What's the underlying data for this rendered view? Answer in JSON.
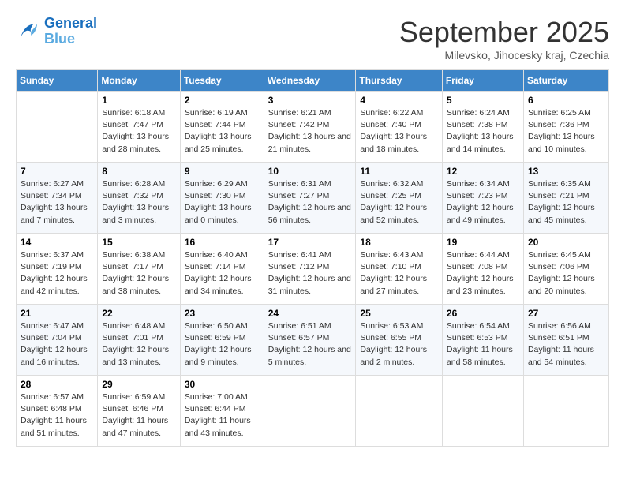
{
  "logo": {
    "line1": "General",
    "line2": "Blue"
  },
  "title": "September 2025",
  "subtitle": "Milevsko, Jihocesky kraj, Czechia",
  "days_header": [
    "Sunday",
    "Monday",
    "Tuesday",
    "Wednesday",
    "Thursday",
    "Friday",
    "Saturday"
  ],
  "weeks": [
    [
      {
        "day": "",
        "info": ""
      },
      {
        "day": "1",
        "info": "Sunrise: 6:18 AM\nSunset: 7:47 PM\nDaylight: 13 hours and 28 minutes."
      },
      {
        "day": "2",
        "info": "Sunrise: 6:19 AM\nSunset: 7:44 PM\nDaylight: 13 hours and 25 minutes."
      },
      {
        "day": "3",
        "info": "Sunrise: 6:21 AM\nSunset: 7:42 PM\nDaylight: 13 hours and 21 minutes."
      },
      {
        "day": "4",
        "info": "Sunrise: 6:22 AM\nSunset: 7:40 PM\nDaylight: 13 hours and 18 minutes."
      },
      {
        "day": "5",
        "info": "Sunrise: 6:24 AM\nSunset: 7:38 PM\nDaylight: 13 hours and 14 minutes."
      },
      {
        "day": "6",
        "info": "Sunrise: 6:25 AM\nSunset: 7:36 PM\nDaylight: 13 hours and 10 minutes."
      }
    ],
    [
      {
        "day": "7",
        "info": "Sunrise: 6:27 AM\nSunset: 7:34 PM\nDaylight: 13 hours and 7 minutes."
      },
      {
        "day": "8",
        "info": "Sunrise: 6:28 AM\nSunset: 7:32 PM\nDaylight: 13 hours and 3 minutes."
      },
      {
        "day": "9",
        "info": "Sunrise: 6:29 AM\nSunset: 7:30 PM\nDaylight: 13 hours and 0 minutes."
      },
      {
        "day": "10",
        "info": "Sunrise: 6:31 AM\nSunset: 7:27 PM\nDaylight: 12 hours and 56 minutes."
      },
      {
        "day": "11",
        "info": "Sunrise: 6:32 AM\nSunset: 7:25 PM\nDaylight: 12 hours and 52 minutes."
      },
      {
        "day": "12",
        "info": "Sunrise: 6:34 AM\nSunset: 7:23 PM\nDaylight: 12 hours and 49 minutes."
      },
      {
        "day": "13",
        "info": "Sunrise: 6:35 AM\nSunset: 7:21 PM\nDaylight: 12 hours and 45 minutes."
      }
    ],
    [
      {
        "day": "14",
        "info": "Sunrise: 6:37 AM\nSunset: 7:19 PM\nDaylight: 12 hours and 42 minutes."
      },
      {
        "day": "15",
        "info": "Sunrise: 6:38 AM\nSunset: 7:17 PM\nDaylight: 12 hours and 38 minutes."
      },
      {
        "day": "16",
        "info": "Sunrise: 6:40 AM\nSunset: 7:14 PM\nDaylight: 12 hours and 34 minutes."
      },
      {
        "day": "17",
        "info": "Sunrise: 6:41 AM\nSunset: 7:12 PM\nDaylight: 12 hours and 31 minutes."
      },
      {
        "day": "18",
        "info": "Sunrise: 6:43 AM\nSunset: 7:10 PM\nDaylight: 12 hours and 27 minutes."
      },
      {
        "day": "19",
        "info": "Sunrise: 6:44 AM\nSunset: 7:08 PM\nDaylight: 12 hours and 23 minutes."
      },
      {
        "day": "20",
        "info": "Sunrise: 6:45 AM\nSunset: 7:06 PM\nDaylight: 12 hours and 20 minutes."
      }
    ],
    [
      {
        "day": "21",
        "info": "Sunrise: 6:47 AM\nSunset: 7:04 PM\nDaylight: 12 hours and 16 minutes."
      },
      {
        "day": "22",
        "info": "Sunrise: 6:48 AM\nSunset: 7:01 PM\nDaylight: 12 hours and 13 minutes."
      },
      {
        "day": "23",
        "info": "Sunrise: 6:50 AM\nSunset: 6:59 PM\nDaylight: 12 hours and 9 minutes."
      },
      {
        "day": "24",
        "info": "Sunrise: 6:51 AM\nSunset: 6:57 PM\nDaylight: 12 hours and 5 minutes."
      },
      {
        "day": "25",
        "info": "Sunrise: 6:53 AM\nSunset: 6:55 PM\nDaylight: 12 hours and 2 minutes."
      },
      {
        "day": "26",
        "info": "Sunrise: 6:54 AM\nSunset: 6:53 PM\nDaylight: 11 hours and 58 minutes."
      },
      {
        "day": "27",
        "info": "Sunrise: 6:56 AM\nSunset: 6:51 PM\nDaylight: 11 hours and 54 minutes."
      }
    ],
    [
      {
        "day": "28",
        "info": "Sunrise: 6:57 AM\nSunset: 6:48 PM\nDaylight: 11 hours and 51 minutes."
      },
      {
        "day": "29",
        "info": "Sunrise: 6:59 AM\nSunset: 6:46 PM\nDaylight: 11 hours and 47 minutes."
      },
      {
        "day": "30",
        "info": "Sunrise: 7:00 AM\nSunset: 6:44 PM\nDaylight: 11 hours and 43 minutes."
      },
      {
        "day": "",
        "info": ""
      },
      {
        "day": "",
        "info": ""
      },
      {
        "day": "",
        "info": ""
      },
      {
        "day": "",
        "info": ""
      }
    ]
  ]
}
